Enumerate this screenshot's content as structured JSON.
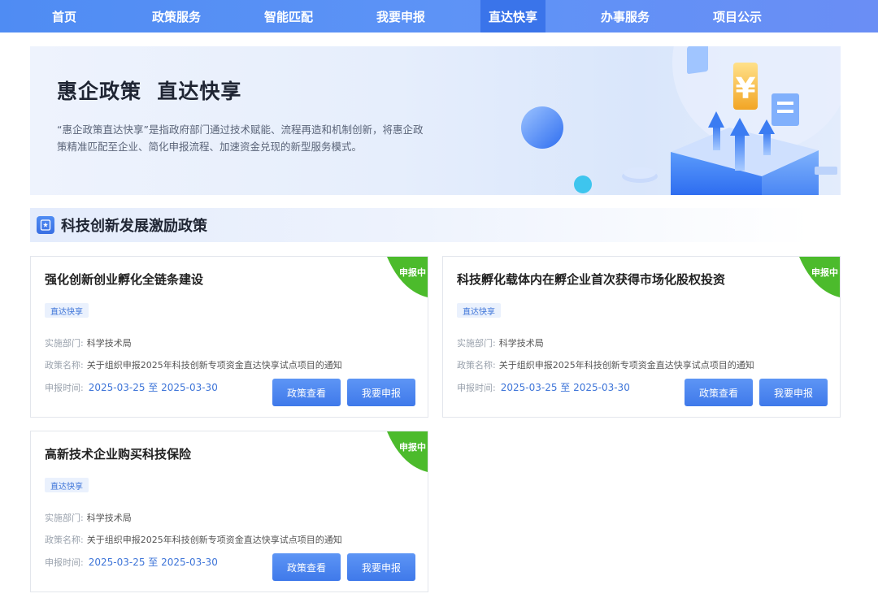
{
  "nav": {
    "items": [
      "首页",
      "政策服务",
      "智能匹配",
      "我要申报",
      "直达快享",
      "办事服务",
      "项目公示"
    ],
    "active_index": 4
  },
  "banner": {
    "title": "惠企政策  直达快享",
    "description": "“惠企政策直达快享”是指政府部门通过技术赋能、流程再造和机制创新，将惠企政策精准匹配至企业、简化申报流程、加速资金兑现的新型服务模式。"
  },
  "section": {
    "title": "科技创新发展激励政策",
    "icon": "star-doc-icon"
  },
  "colors": {
    "primary": "#3f79ea",
    "ribbon": "#4cbb2c",
    "tag_bg": "#eaf1fd"
  },
  "cards": [
    {
      "title": "强化创新创业孵化全链条建设",
      "status": "申报中",
      "tag": "直达快享",
      "dept_label": "实施部门:",
      "dept": "科学技术局",
      "policy_label": "政策名称:",
      "policy": "关于组织申报2025年科技创新专项资金直达快享试点项目的通知",
      "time_label": "申报时间:",
      "time": "2025-03-25 至 2025-03-30",
      "view_label": "政策查看",
      "apply_label": "我要申报"
    },
    {
      "title": "科技孵化载体内在孵企业首次获得市场化股权投资",
      "status": "申报中",
      "tag": "直达快享",
      "dept_label": "实施部门:",
      "dept": "科学技术局",
      "policy_label": "政策名称:",
      "policy": "关于组织申报2025年科技创新专项资金直达快享试点项目的通知",
      "time_label": "申报时间:",
      "time": "2025-03-25 至 2025-03-30",
      "view_label": "政策查看",
      "apply_label": "我要申报"
    },
    {
      "title": "高新技术企业购买科技保险",
      "status": "申报中",
      "tag": "直达快享",
      "dept_label": "实施部门:",
      "dept": "科学技术局",
      "policy_label": "政策名称:",
      "policy": "关于组织申报2025年科技创新专项资金直达快享试点项目的通知",
      "time_label": "申报时间:",
      "time": "2025-03-25 至 2025-03-30",
      "view_label": "政策查看",
      "apply_label": "我要申报"
    }
  ]
}
